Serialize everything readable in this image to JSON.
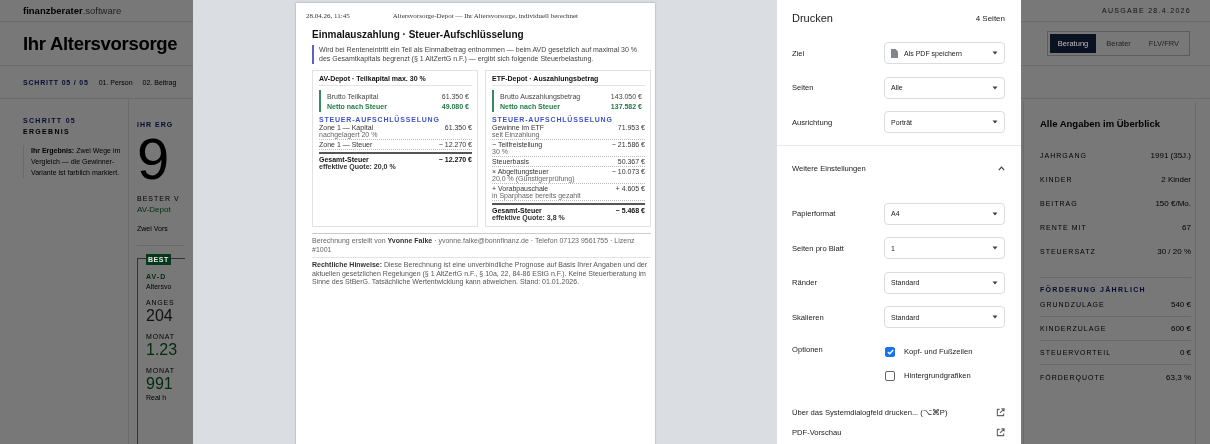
{
  "app": {
    "logo": {
      "name": "finanzberater",
      "suffix": ".software"
    },
    "edition": "AUSGABE 28.4.2026",
    "title": "Ihr Altersvorsorge",
    "view_tabs": [
      {
        "label": "Beratung",
        "selected": true
      },
      {
        "label": "Berater",
        "selected": false
      },
      {
        "label": "FLV/FRV",
        "selected": false
      }
    ],
    "stepper": {
      "label": "SCHRITT 05 / 05",
      "steps": [
        "01. Person",
        "02. Beitrag"
      ]
    },
    "sidebar": {
      "step": "SCHRITT 05",
      "name": "ERGEBNIS",
      "note": "**Ihr Ergebnis:** Zwei Wege im Vergleich — die Gewinner-Variante ist farblich markiert."
    },
    "result": {
      "label": "IHR ERG",
      "value": "9",
      "best_label": "BESTER V",
      "best_name": "AV-Depot",
      "intro": "Zwei Vors",
      "card": {
        "badge": "BEST",
        "title": "AV-D",
        "subtitle": "Altersvo",
        "metrics": [
          {
            "label": "ANGES",
            "value": "204",
            "kind": "plain"
          },
          {
            "label": "MONAT",
            "value": "1.23",
            "kind": "highlight"
          },
          {
            "label": "MONAT",
            "value": "991",
            "kind": "highlight",
            "note": "Real h"
          }
        ]
      }
    },
    "summary": {
      "title": "Alle Angaben im Überblick",
      "rows": [
        {
          "label": "JAHRGANG",
          "value": "1991 (35J.)"
        },
        {
          "label": "KINDER",
          "value": "2 Kinder"
        },
        {
          "label": "BEITRAG",
          "value": "150 €/Mo."
        },
        {
          "label": "RENTE MIT",
          "value": "67"
        },
        {
          "label": "STEUERSATZ",
          "value": "30 / 20 %"
        }
      ],
      "section": "FÖRDERUNG JÄHRLICH",
      "section_rows": [
        {
          "label": "GRUNDZULAGE",
          "value": "540 €"
        },
        {
          "label": "KINDERZULAGE",
          "value": "600 €"
        },
        {
          "label": "STEUERVORTEIL",
          "value": "0 €"
        },
        {
          "label": "FÖRDERQUOTE",
          "value": "63,3 %"
        }
      ]
    }
  },
  "print_dialog": {
    "preview": {
      "page_date": "28.04.26, 11:45",
      "page_header": "Altersvorsorge-Depot — Ihr Altersvorsorge, individuell berechnet",
      "title": "Einmalauszahlung · Steuer-Aufschlüsselung",
      "intro": "Wird bei Renteneintritt ein Teil als Einmalbetrag entnommen — beim AVD gesetzlich auf maximal 30 % des Gesamtkapitals begrenzt (§ 1 AltZertG n.F.) — ergibt sich folgende Steuerbelastung.",
      "cards": [
        {
          "title": "AV-Depot · Teilkapital max. 30 %",
          "summary": [
            {
              "label": "Brutto Teilkapital",
              "value": "61.350 €",
              "kind": "gross"
            },
            {
              "label": "Netto nach Steuer",
              "value": "49.080 €",
              "kind": "net"
            }
          ],
          "breakdown_title": "STEUER-AUFSCHLÜSSELUNG",
          "items": [
            {
              "label": "Zone 1 — Kapital",
              "value": "61.350 €",
              "note": "nachgelagert 20 %"
            },
            {
              "label": "Zone 1 — Steuer",
              "value": "− 12.270 €"
            }
          ],
          "total": {
            "label": "Gesamt-Steuer",
            "value": "− 12.270 €",
            "note": "effektive Quote: 20,0 %"
          }
        },
        {
          "title": "ETF-Depot · Auszahlungsbetrag",
          "summary": [
            {
              "label": "Brutto Auszahlungsbetrag",
              "value": "143.050 €",
              "kind": "gross"
            },
            {
              "label": "Netto nach Steuer",
              "value": "137.582 €",
              "kind": "net"
            }
          ],
          "breakdown_title": "STEUER-AUFSCHLÜSSELUNG",
          "items": [
            {
              "label": "Gewinne im ETF",
              "value": "71.953 €",
              "note": "seit Einzahlung"
            },
            {
              "label": "− Teilfreistellung",
              "value": "− 21.586 €",
              "note": "30 %"
            },
            {
              "label": "Steuerbasis",
              "value": "50.367 €"
            },
            {
              "label": "× Abgeltungsteuer",
              "value": "− 10.073 €",
              "note": "20,0 % (Günstigerprüfung)"
            },
            {
              "label": "+ Vorabpauschale",
              "value": "+ 4.605 €",
              "note": "in Sparphase bereits gezahlt"
            }
          ],
          "total": {
            "label": "Gesamt-Steuer",
            "value": "− 5.468 €",
            "note": "effektive Quote: 3,8 %"
          }
        }
      ],
      "author_line": "Berechnung erstellt von **Yvonne Falke** · yvonne.falke@bonnfinanz.de · Telefon 07123 9561755 · Lizenz #1001",
      "legal": "**Rechtliche Hinweise:** Diese Berechnung ist eine unverbindliche Prognose auf Basis Ihrer Angaben und der aktuellen gesetzlichen Regelungen (§ 1 AltZertG n.F., § 10a, 22, 84-86 EStG n.F.). Keine Steuerberatung im Sinne des StBerG. Tatsächliche Wertentwicklung kann abweichen. Stand: 01.01.2026."
    },
    "settings": {
      "title": "Drucken",
      "page_count": "4 Seiten",
      "fields": [
        {
          "label": "Ziel",
          "value": "Als PDF speichern",
          "kind": "destination"
        },
        {
          "label": "Seiten",
          "value": "Alle",
          "kind": "select"
        },
        {
          "label": "Ausrichtung",
          "value": "Porträt",
          "kind": "select"
        }
      ],
      "more": {
        "label": "Weitere Einstellungen",
        "expanded": true
      },
      "more_fields": [
        {
          "label": "Papierformat",
          "value": "A4",
          "kind": "select"
        },
        {
          "label": "Seiten pro Blatt",
          "value": "1",
          "kind": "select"
        },
        {
          "label": "Ränder",
          "value": "Standard",
          "kind": "select"
        },
        {
          "label": "Skalieren",
          "value": "Standard",
          "kind": "select"
        }
      ],
      "options": {
        "label": "Optionen",
        "checkboxes": [
          {
            "label": "Kopf- und Fußzeilen",
            "checked": true
          },
          {
            "label": "Hintergrundgrafiken",
            "checked": false
          }
        ]
      },
      "links": [
        "Über das Systemdialogfeld drucken... (⌥⌘P)",
        "PDF-Vorschau"
      ]
    }
  }
}
